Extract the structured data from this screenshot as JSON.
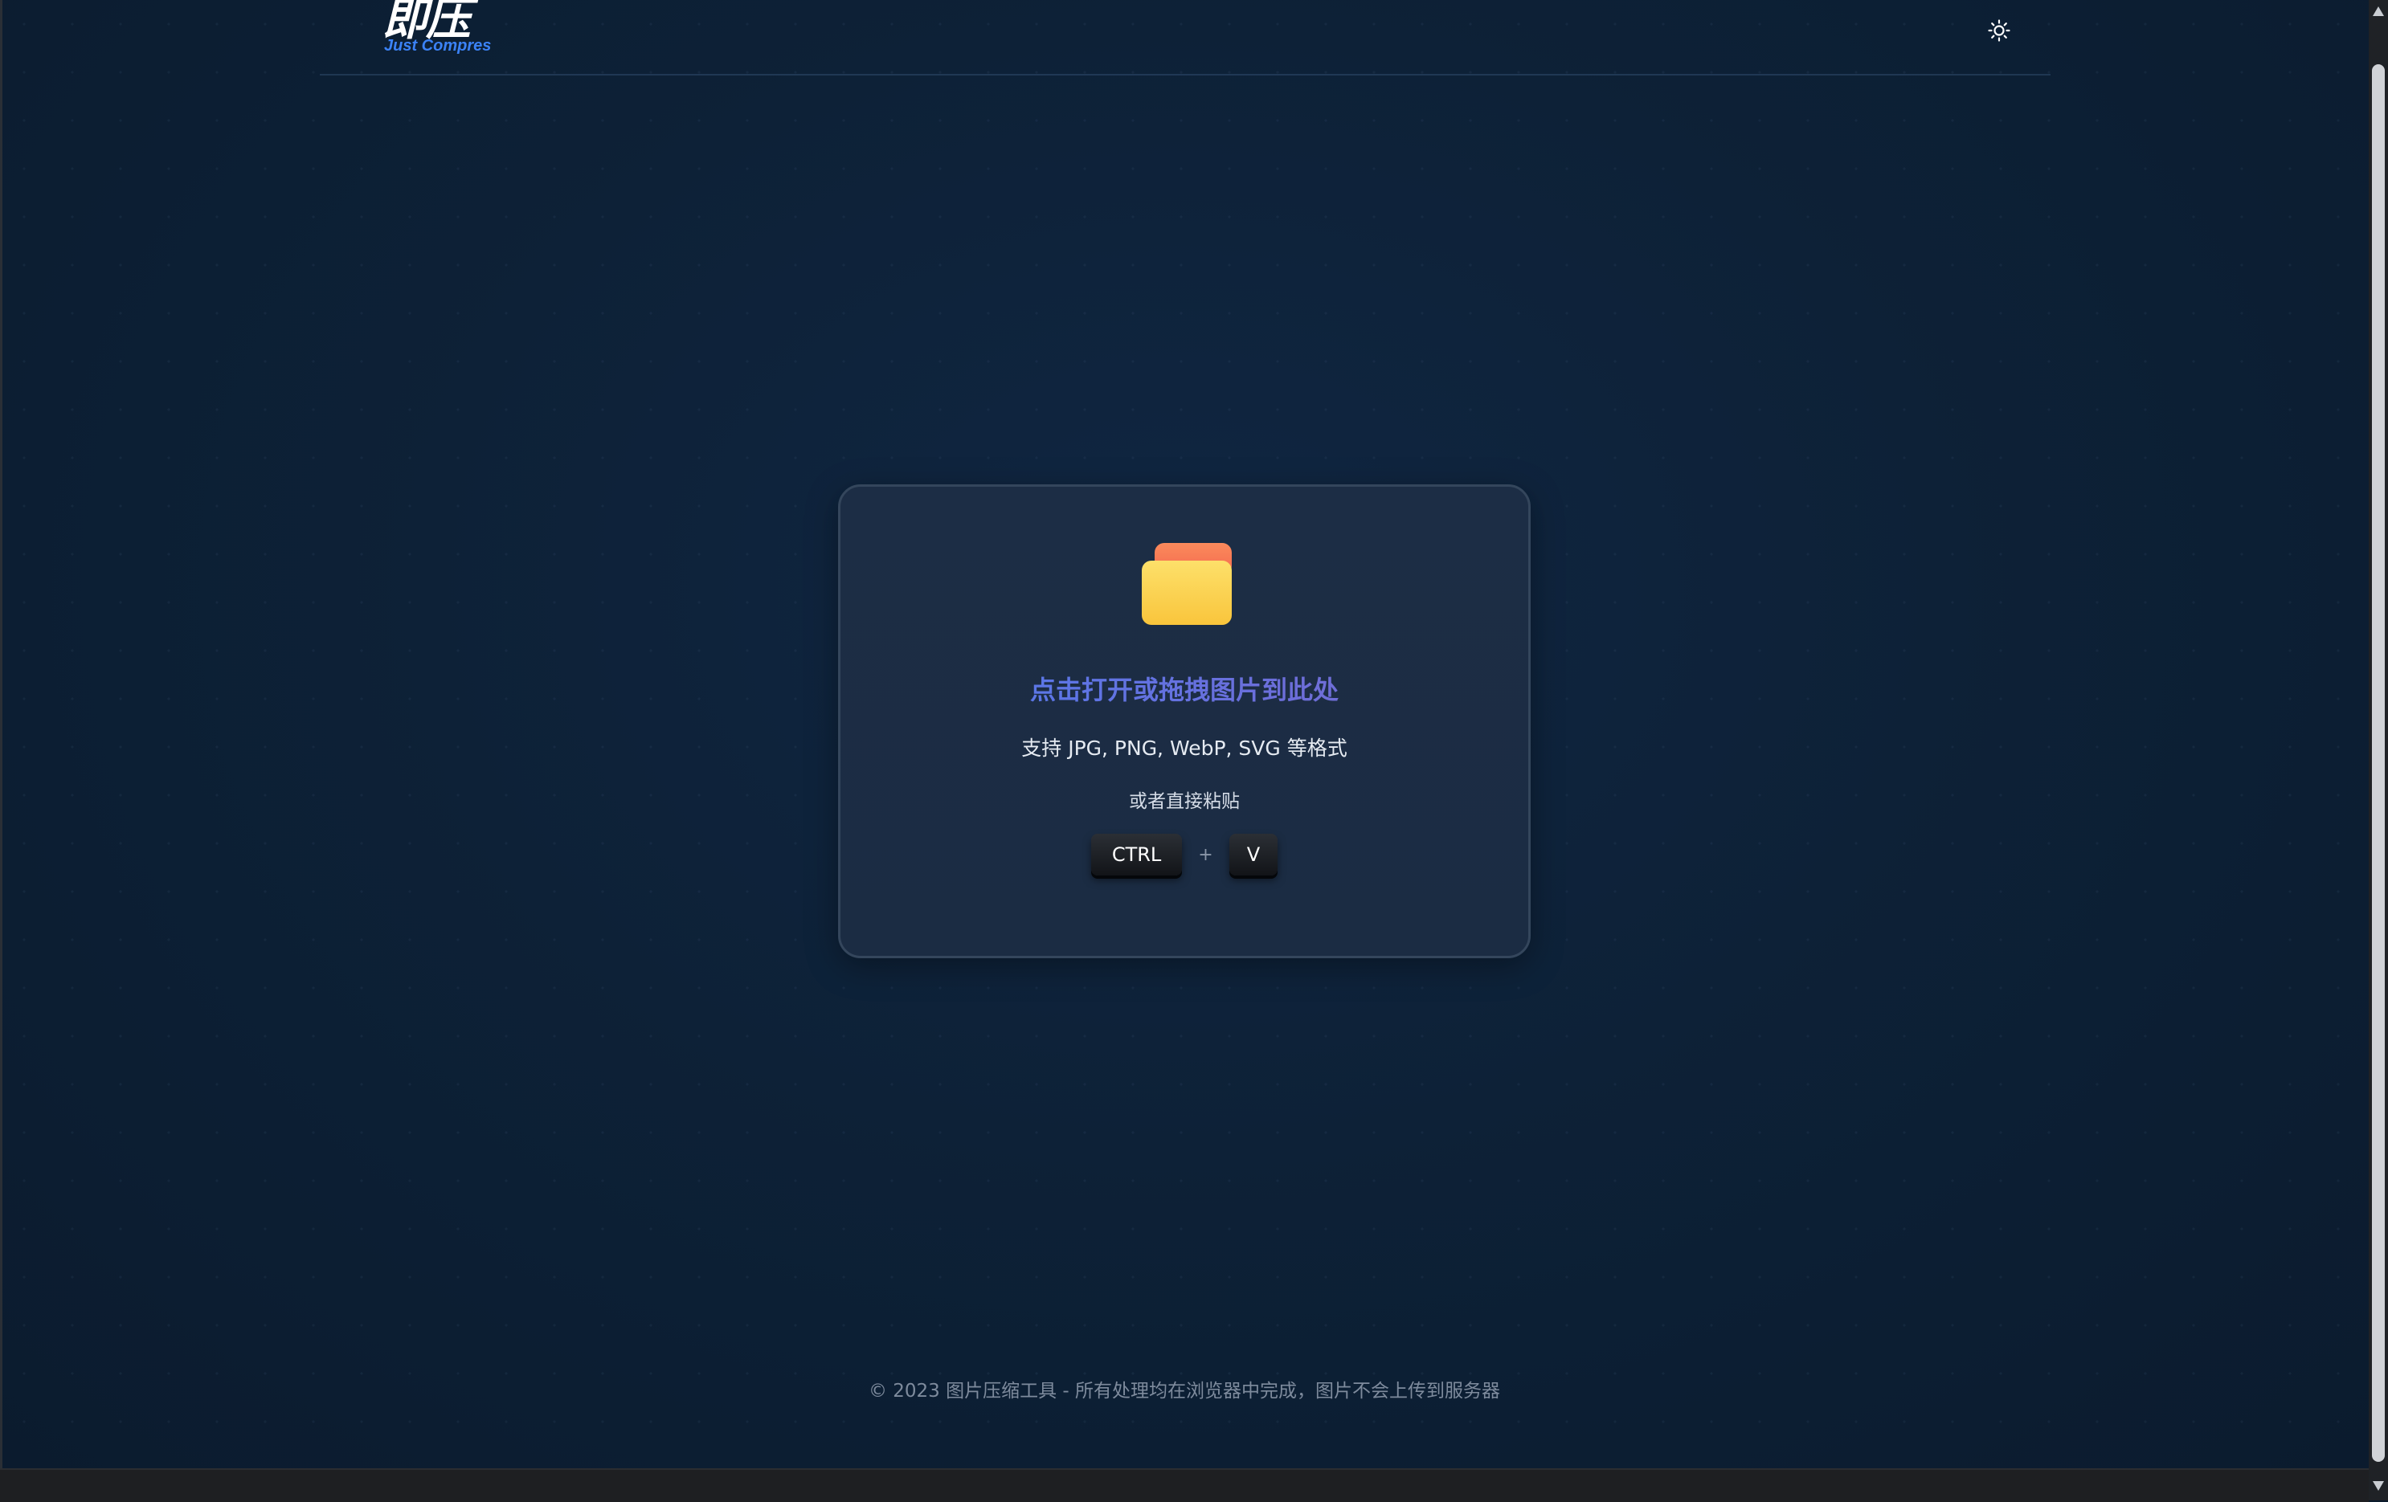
{
  "header": {
    "logo_cn": "即压",
    "logo_en": "Just Compres",
    "theme_toggle_icon": "sun-icon"
  },
  "upload": {
    "folder_icon": "folder-icon",
    "title": "点击打开或拖拽图片到此处",
    "formats": "支持 JPG, PNG, WebP, SVG 等格式",
    "paste_hint": "或者直接粘贴",
    "keys": {
      "ctrl": "CTRL",
      "plus": "+",
      "v": "V"
    }
  },
  "footer": {
    "text": "© 2023 图片压缩工具 - 所有处理均在浏览器中完成，图片不会上传到服务器"
  },
  "colors": {
    "background": "#0d2137",
    "card": "#1c2d45",
    "accent": "#4f7cf0",
    "folder_top": "#f97b5a",
    "folder_body": "#fcd24d"
  }
}
